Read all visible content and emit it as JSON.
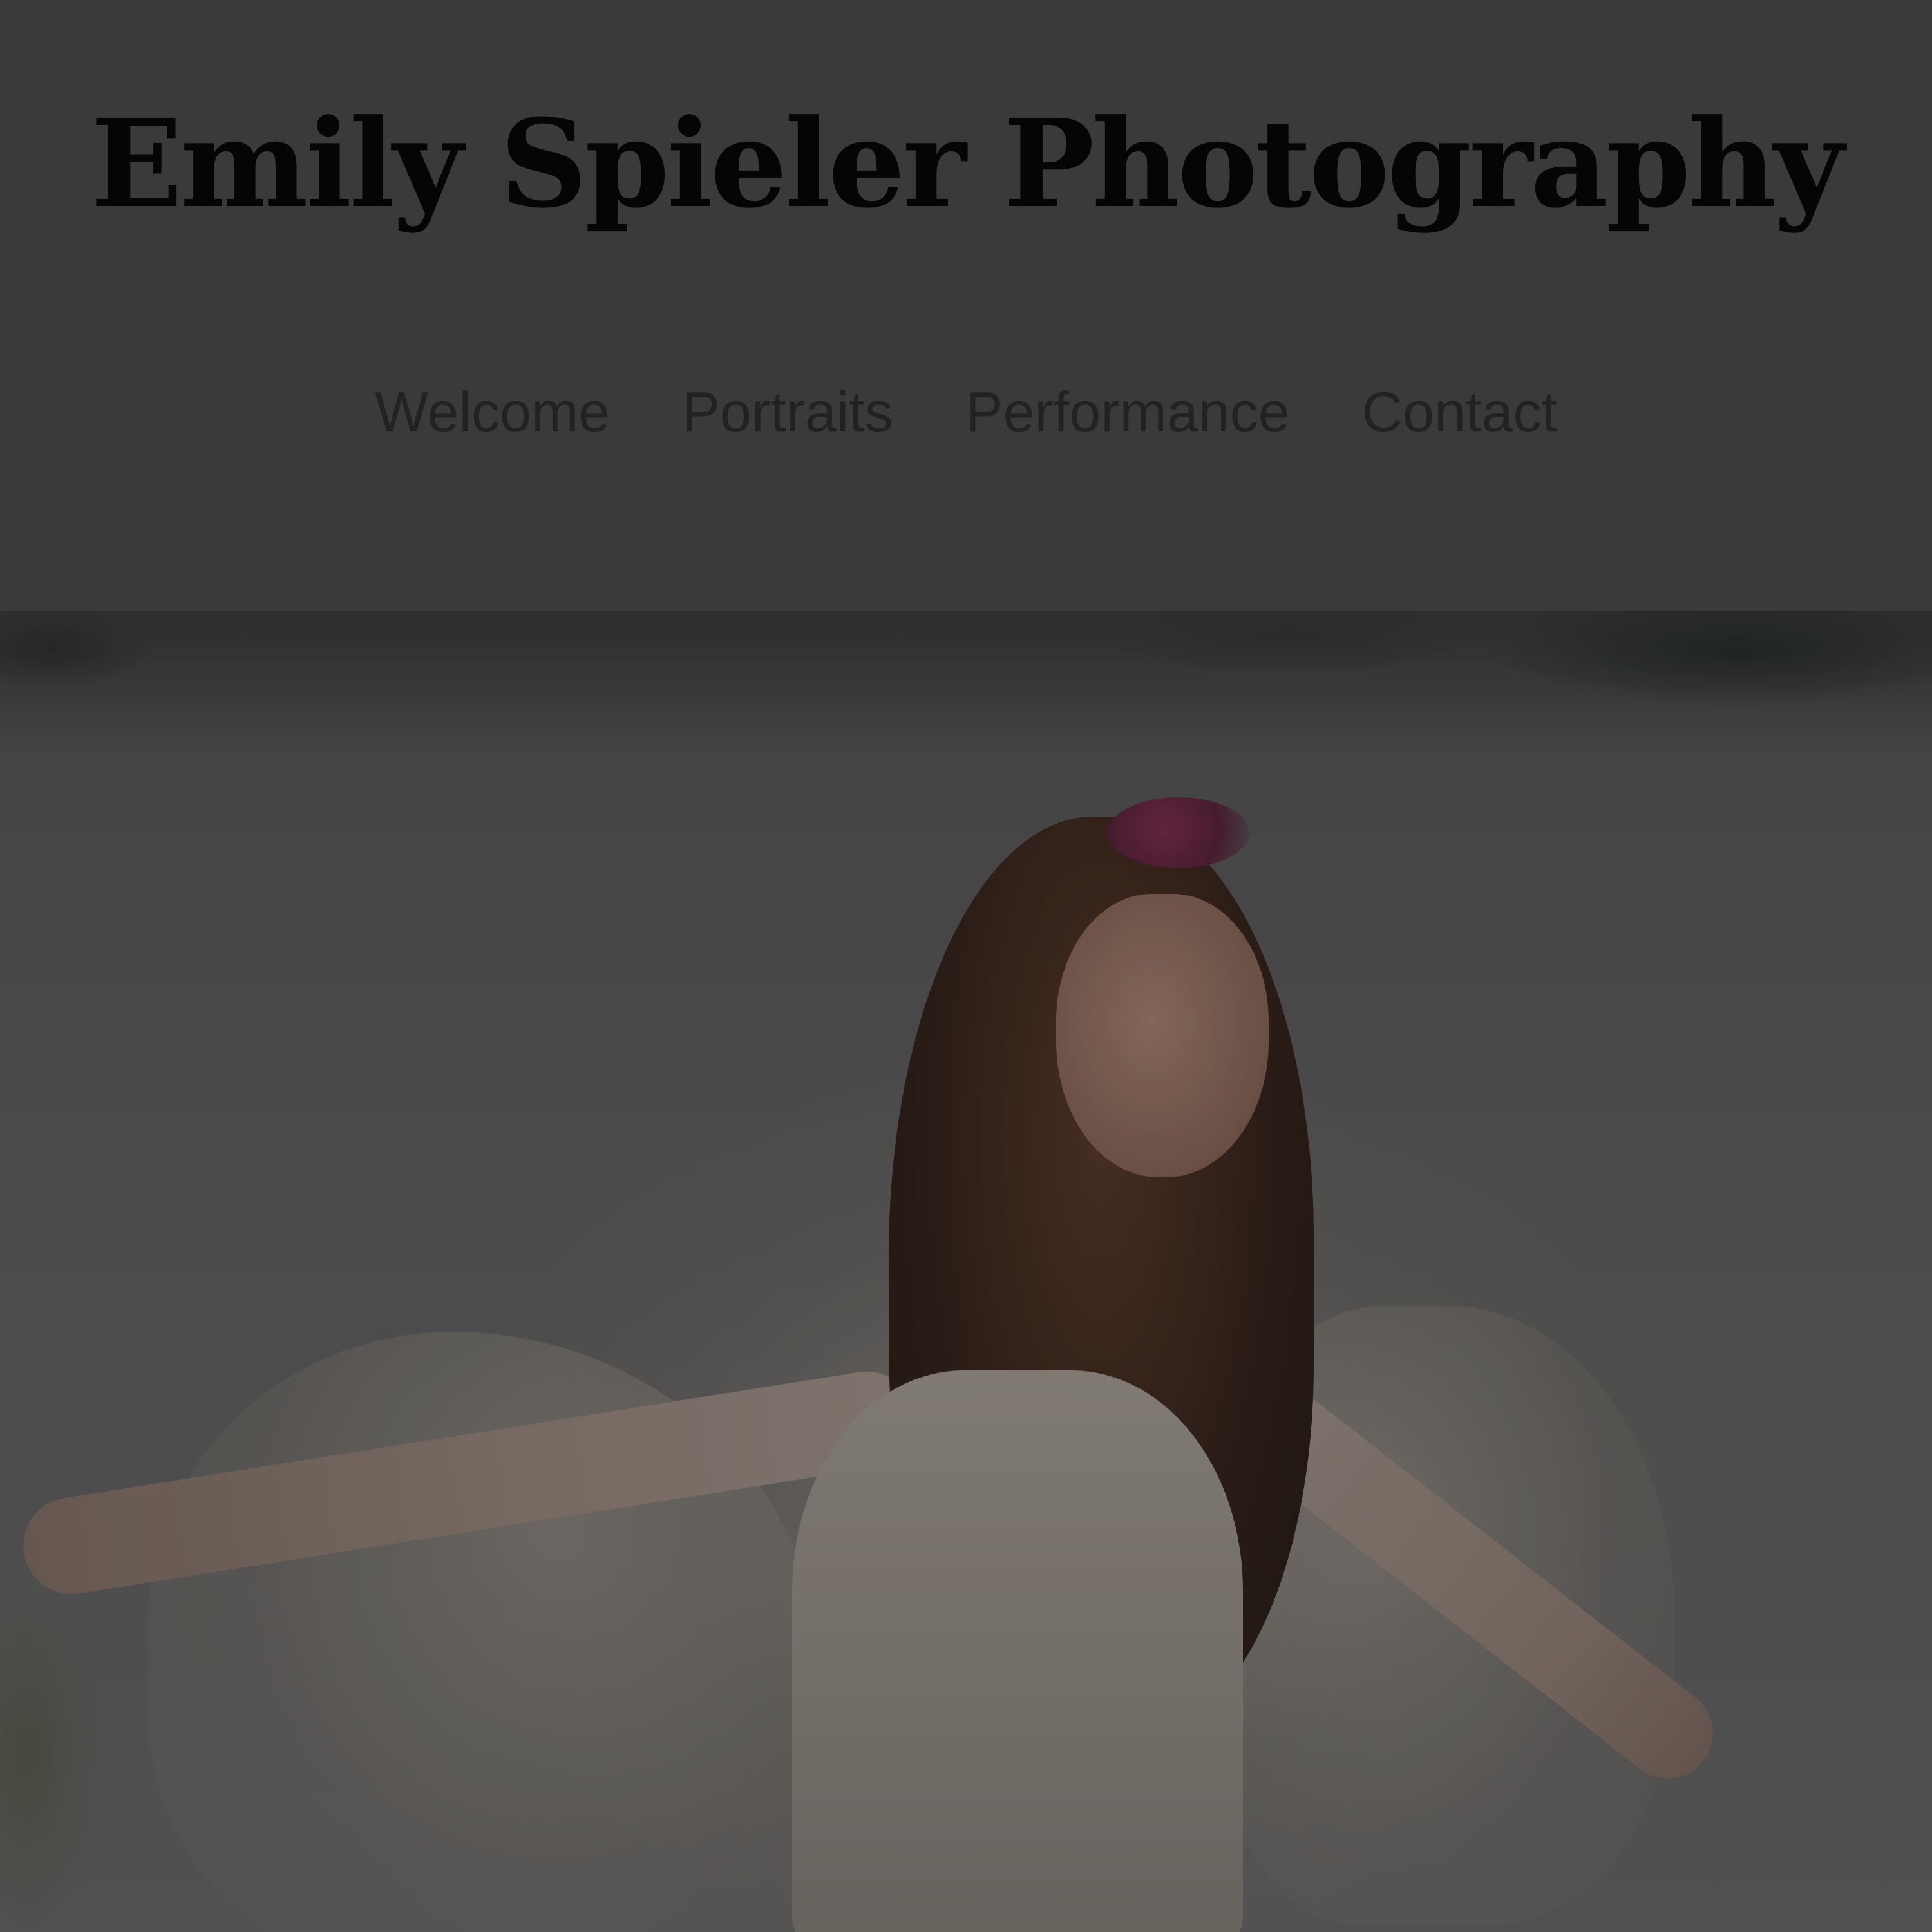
{
  "site": {
    "title": "Emily Spieler Photography"
  },
  "nav": {
    "items": [
      {
        "label": "Welcome"
      },
      {
        "label": "Portraits"
      },
      {
        "label": "Performance"
      },
      {
        "label": "Contact"
      }
    ]
  },
  "colors": {
    "page_background": "#3a3a3a",
    "title_text": "#050505",
    "nav_text": "#222222"
  }
}
